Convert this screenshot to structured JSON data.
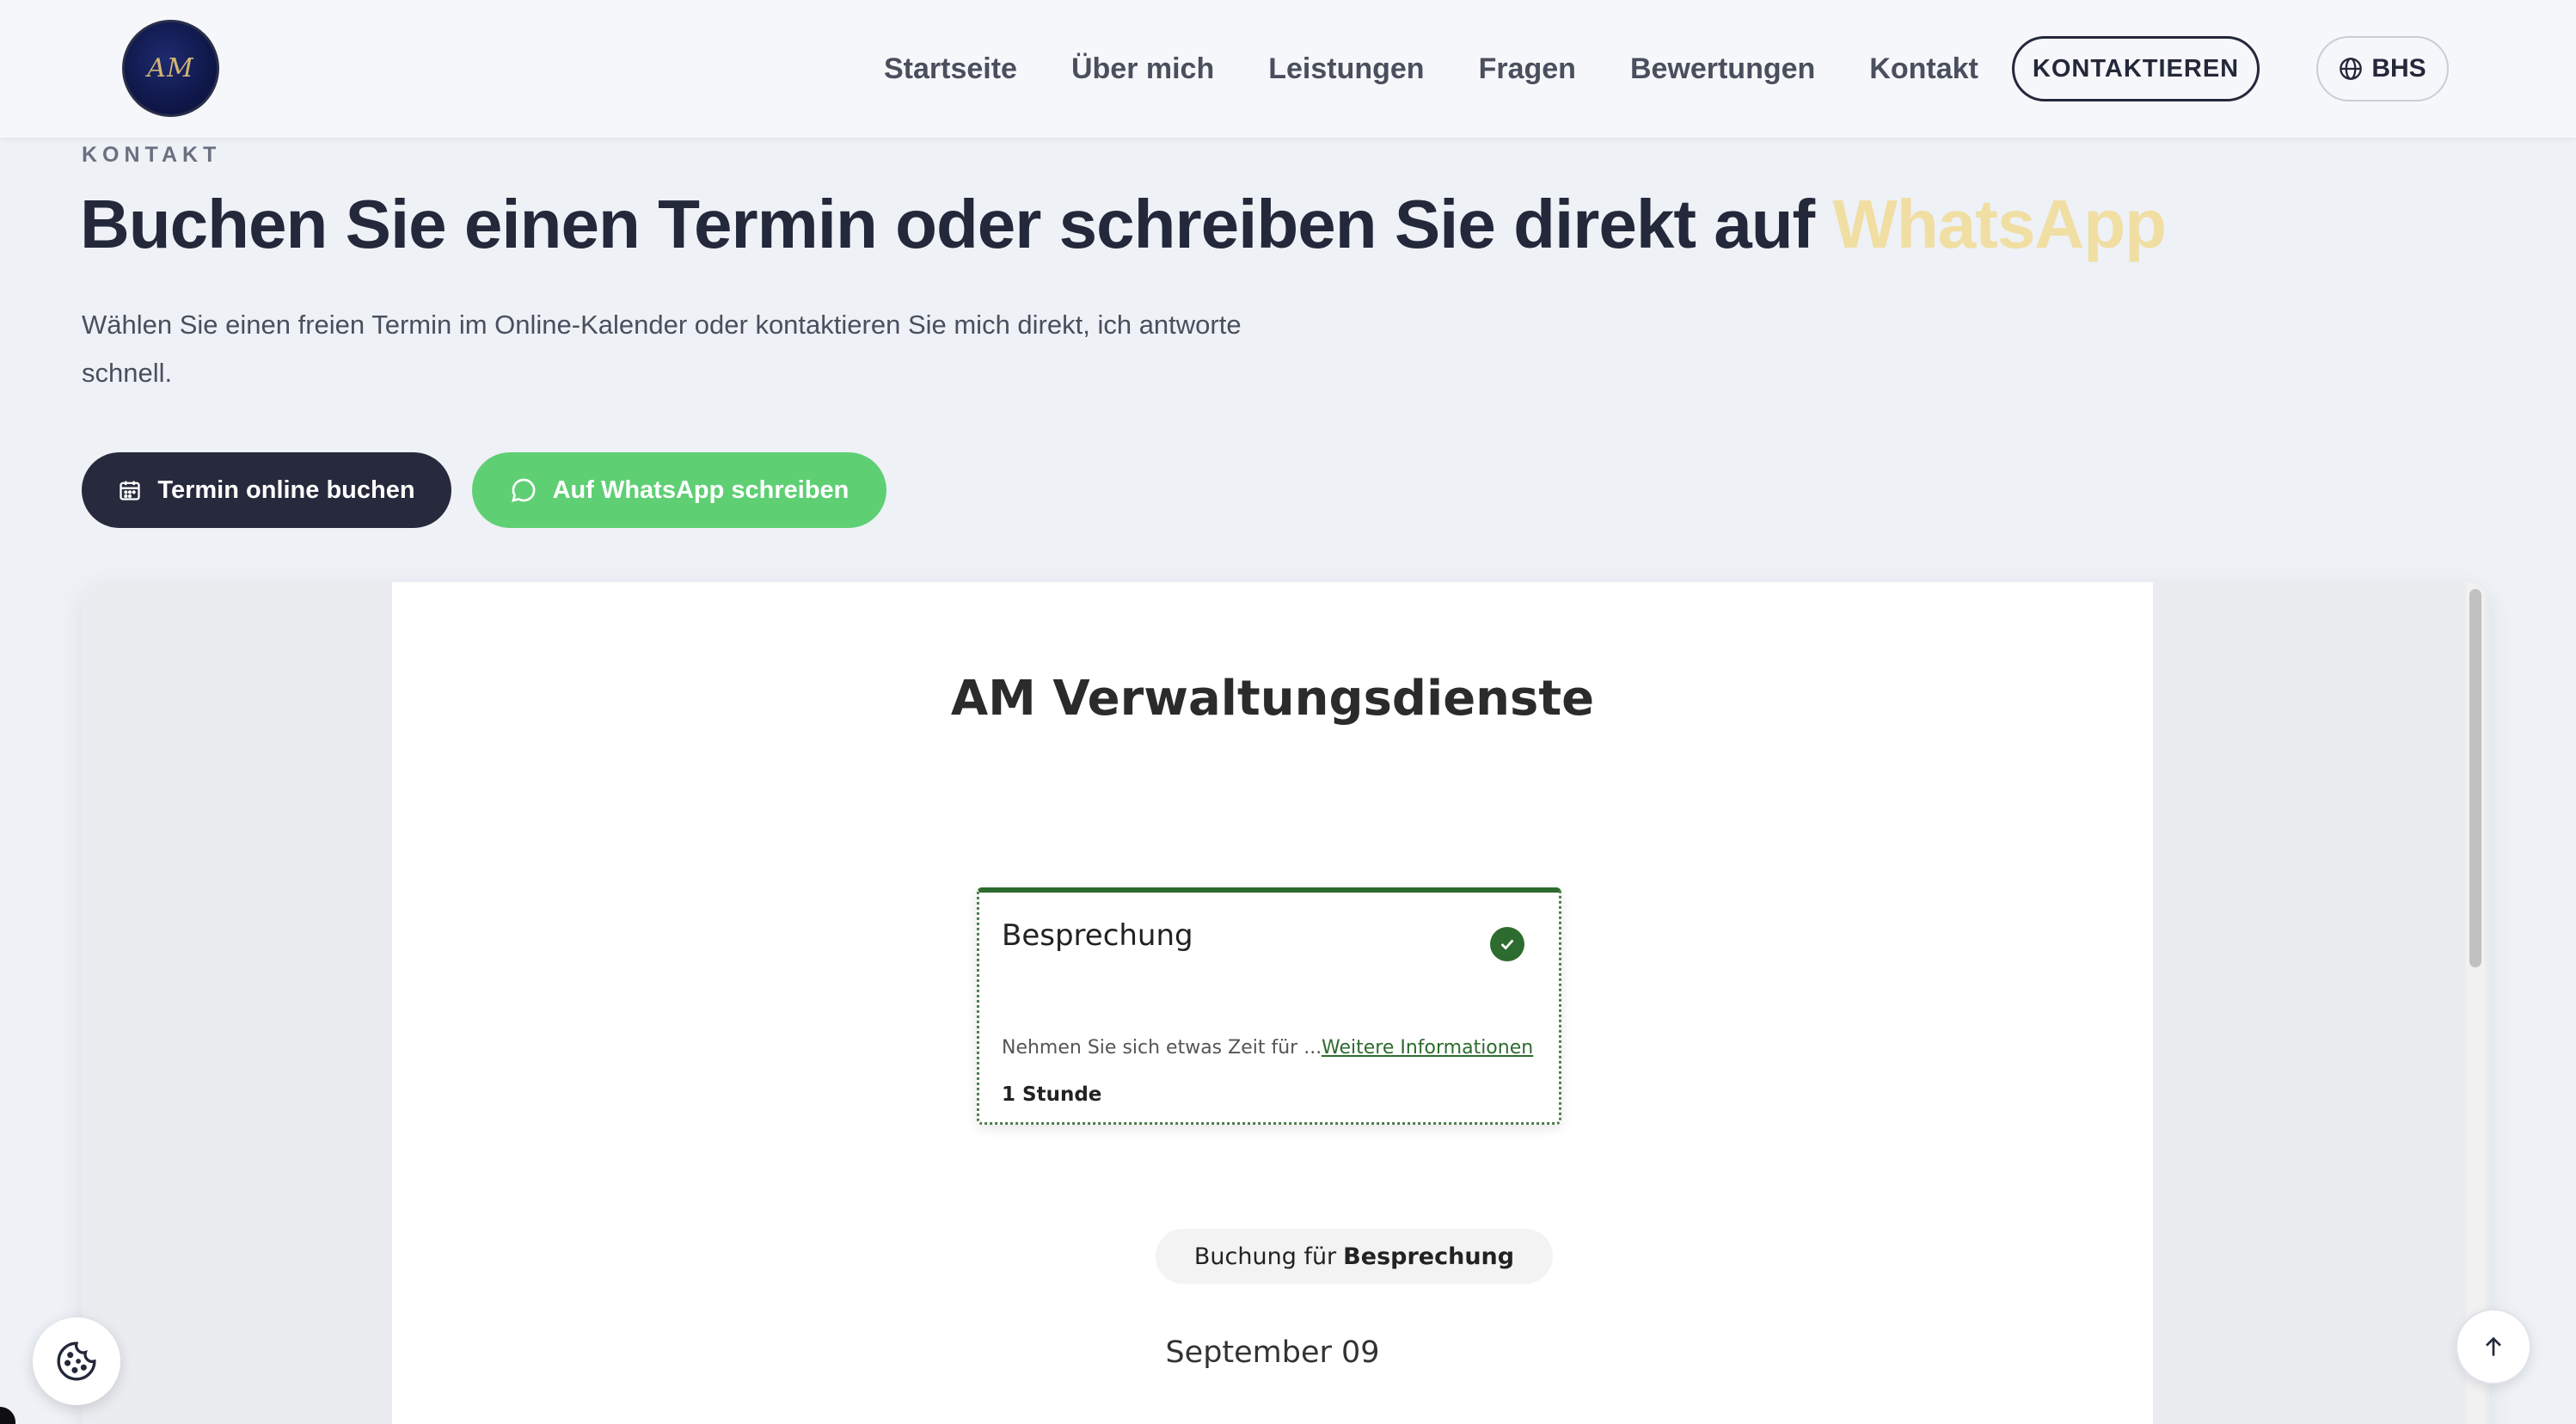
{
  "header": {
    "logo_text": "AM",
    "nav": [
      "Startseite",
      "Über mich",
      "Leistungen",
      "Fragen",
      "Bewertungen",
      "Kontakt"
    ],
    "cta_label": "KONTAKTIEREN",
    "lang_label": "BHS",
    "lang_icon": "globe-icon"
  },
  "hero": {
    "eyebrow": "KONTAKT",
    "headline_main": "Buchen Sie einen Termin oder schreiben Sie direkt auf ",
    "headline_accent": "WhatsApp",
    "accent_color": "#f0dea3",
    "lead": "Wählen Sie einen freien Termin im Online-Kalender oder kontaktieren Sie mich direkt, ich antworte schnell.",
    "book_button": "Termin online buchen",
    "book_icon": "calendar-icon",
    "whatsapp_button": "Auf WhatsApp schreiben",
    "whatsapp_icon": "chat-bubble-icon",
    "whatsapp_color": "#5fcf74"
  },
  "booking_widget": {
    "company": "AM Verwaltungsdienste",
    "service": {
      "name": "Besprechung",
      "description": "Nehmen Sie sich etwas Zeit für ...",
      "more_link": "Weitere Informationen",
      "duration": "1 Stunde",
      "selected": true,
      "accent_color": "#2e6b2e"
    },
    "booking_for_prefix": "Buchung für",
    "booking_for_service": "Besprechung",
    "date_label": "September 09"
  },
  "floating": {
    "cookie_icon": "cookie-icon",
    "scroll_top_icon": "arrow-up-icon"
  }
}
